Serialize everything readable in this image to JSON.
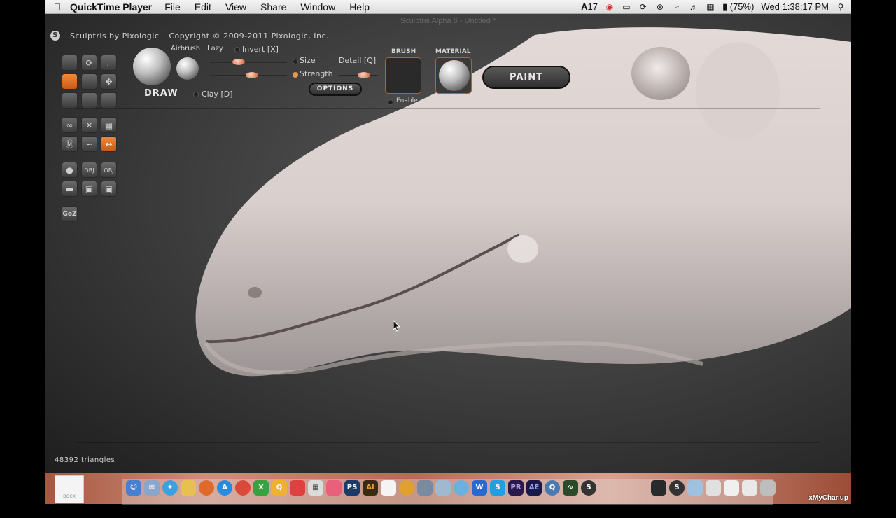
{
  "menubar": {
    "app_name": "QuickTime Player",
    "menus": [
      "File",
      "Edit",
      "View",
      "Share",
      "Window",
      "Help"
    ],
    "adobe_badge": "17",
    "battery": "(75%)",
    "clock": "Wed 1:38:17 PM"
  },
  "window": {
    "title": "Sculptris Alpha 6 - Untitled *",
    "brand": "Sculptris by Pixologic",
    "copyright": "Copyright © 2009-2011 Pixologic, Inc."
  },
  "toolbar": {
    "tool_label": "DRAW",
    "airbrush": "Airbrush",
    "lazy": "Lazy",
    "invert": "Invert [X]",
    "size": "Size",
    "strength": "Strength",
    "detail": "Detail [Q]",
    "options": "OPTIONS",
    "clay": "Clay [D]",
    "brush_label": "BRUSH",
    "material_label": "MATERIAL",
    "enable": "Enable",
    "paint_button": "PAINT",
    "sliders": {
      "size": 0.35,
      "strength": 0.55,
      "detail": 0.7
    }
  },
  "tools": {
    "goz": "GoZ",
    "obj_import": "OBJ",
    "obj_export": "OBJ"
  },
  "status": {
    "triangles": "48392 triangles"
  },
  "dock": {
    "doc_label": "DOCX",
    "file_label": "xMyChar.up",
    "apps": [
      "PS",
      "AI",
      "PR",
      "AE"
    ]
  },
  "colors": {
    "accent": "#e8742c",
    "model": "#e8e0de"
  }
}
